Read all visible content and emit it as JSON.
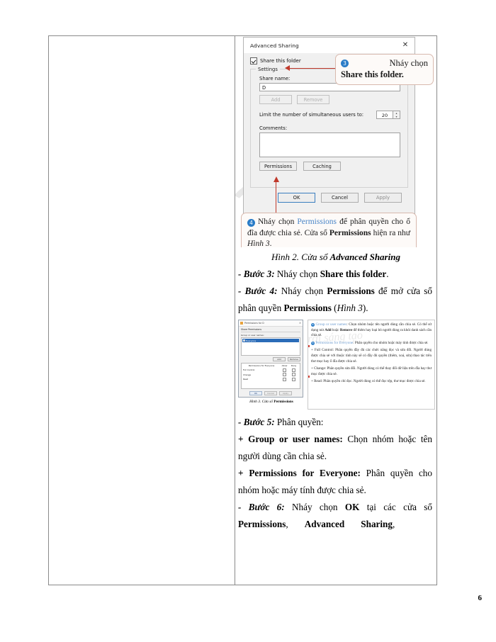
{
  "page": {
    "number": "6"
  },
  "figure2": {
    "dialog": {
      "title": "Advanced Sharing",
      "close_icon": "close-icon",
      "share_checkbox_label": "Share this folder",
      "share_checkbox_checked": true,
      "settings_legend": "Settings",
      "share_name_label": "Share name:",
      "share_name_value": "D",
      "add_button": "Add",
      "remove_button": "Remove",
      "limit_label": "Limit the number of simultaneous users to:",
      "limit_value": "20",
      "comments_label": "Comments:",
      "comments_value": "",
      "permissions_button": "Permissions",
      "caching_button": "Caching",
      "ok_button": "OK",
      "cancel_button": "Cancel",
      "apply_button": "Apply"
    },
    "callout3": {
      "number": "3",
      "line1": "Nháy    chọn",
      "line2": "Share this folder."
    },
    "callout4": {
      "number": "4",
      "t1": "Nháy chọn ",
      "kw1": "Permissions",
      "t2": " để phân quyền cho ổ đĩa được chia sẻ. Cửa sổ ",
      "kw2": "Permissions",
      "t3": " hiện ra như ",
      "kw3": "Hình 3",
      "t4": "."
    },
    "caption": {
      "prefix": "Hình 2. Cửa sổ ",
      "bold": "Advanced Sharing"
    }
  },
  "steps": {
    "step3": {
      "label": "- Bước 3:",
      "text1": " Nháy chọn ",
      "bold1": "Share this folder",
      "text2": "."
    },
    "step4": {
      "label": "- Bước 4:",
      "text1": " Nháy chọn ",
      "bold1": "Permissions",
      "text2": " để mở cửa sổ phân quyền ",
      "bold2": "Permissions",
      "text3": " (",
      "ital1": "Hình 3",
      "text4": ")."
    },
    "step5": {
      "label": "- Bước 5:",
      "text1": " Phân quyền:"
    },
    "bullet_group": {
      "bold": "+ Group or user names:",
      "text": " Chọn nhóm hoặc tên người dùng cần chia sẻ."
    },
    "bullet_perm": {
      "bold": "+ Permissions for Everyone:",
      "text": " Phân quyền cho nhóm hoặc máy tính được chia sẻ."
    },
    "step6": {
      "label": "- Bước 6:",
      "text1": " Nháy chọn ",
      "bold1": "OK",
      "text2": " tại các cửa sổ ",
      "bold2": "Permissions",
      "text3": ",",
      "bold3": "Advanced",
      "bold4": "Sharing",
      "text4": ","
    }
  },
  "figure3": {
    "dialog": {
      "title": "Permissions for D",
      "tab": "Share Permissions",
      "section_label": "Group or user names:",
      "selected_item": "Everyone",
      "add_button": "Add",
      "remove_button": "Remove",
      "table_title": "Permissions for Everyone",
      "col_allow": "Allow",
      "col_deny": "Deny",
      "rows": [
        "Full Control",
        "Change",
        "Read"
      ],
      "ok_button": "OK",
      "cancel_button": "Cancel",
      "apply_button": "Apply"
    },
    "caption": {
      "prefix": "Hình 3. Cửa sổ ",
      "bold": "Permissions"
    },
    "notes": {
      "n1": {
        "num": "a",
        "kw": "Group or user names",
        "t1": ": Chọn nhóm hoặc tên người dùng cần chia sẻ. Có thể sử dụng nút ",
        "b1": "Add",
        "t2": " hoặc ",
        "b2": "Remove",
        "t3": " để thêm hay loại bỏ người dùng ra khỏi danh sách cần chia sẻ."
      },
      "n2": {
        "num": "b",
        "kw1": "Permissions for ",
        "kw2": "Everyone",
        "t1": ": Phân quyền cho nhóm hoặc máy tính được chia sẻ."
      },
      "n3": "+ Full Control: Phân quyền đầy đủ các chức năng đọc và sửa đổi. Người dùng được chia sẻ với thuộc tính này sẽ có đầy đủ quyền (thêm, xoá, sửa) thao tác trên thư mục hay ổ đĩa được chia sẻ.",
      "n4": "+ Change: Phân quyền sửa đổi. Người dùng có thể thay đổi dữ liệu trên đĩa hay thư mục được chia sẻ.",
      "n5": "+ Read: Phân quyền chỉ đọc. Người dùng có thể đọc tệp, thư mục được chia sẻ."
    },
    "watermark": "Chân trời sáng tạo"
  },
  "colors": {
    "accent_blue": "#2a7cc7",
    "arrow_red": "#c0392b",
    "callout_border": "#d8b9ae",
    "keyword_blue": "#4a86c8"
  }
}
